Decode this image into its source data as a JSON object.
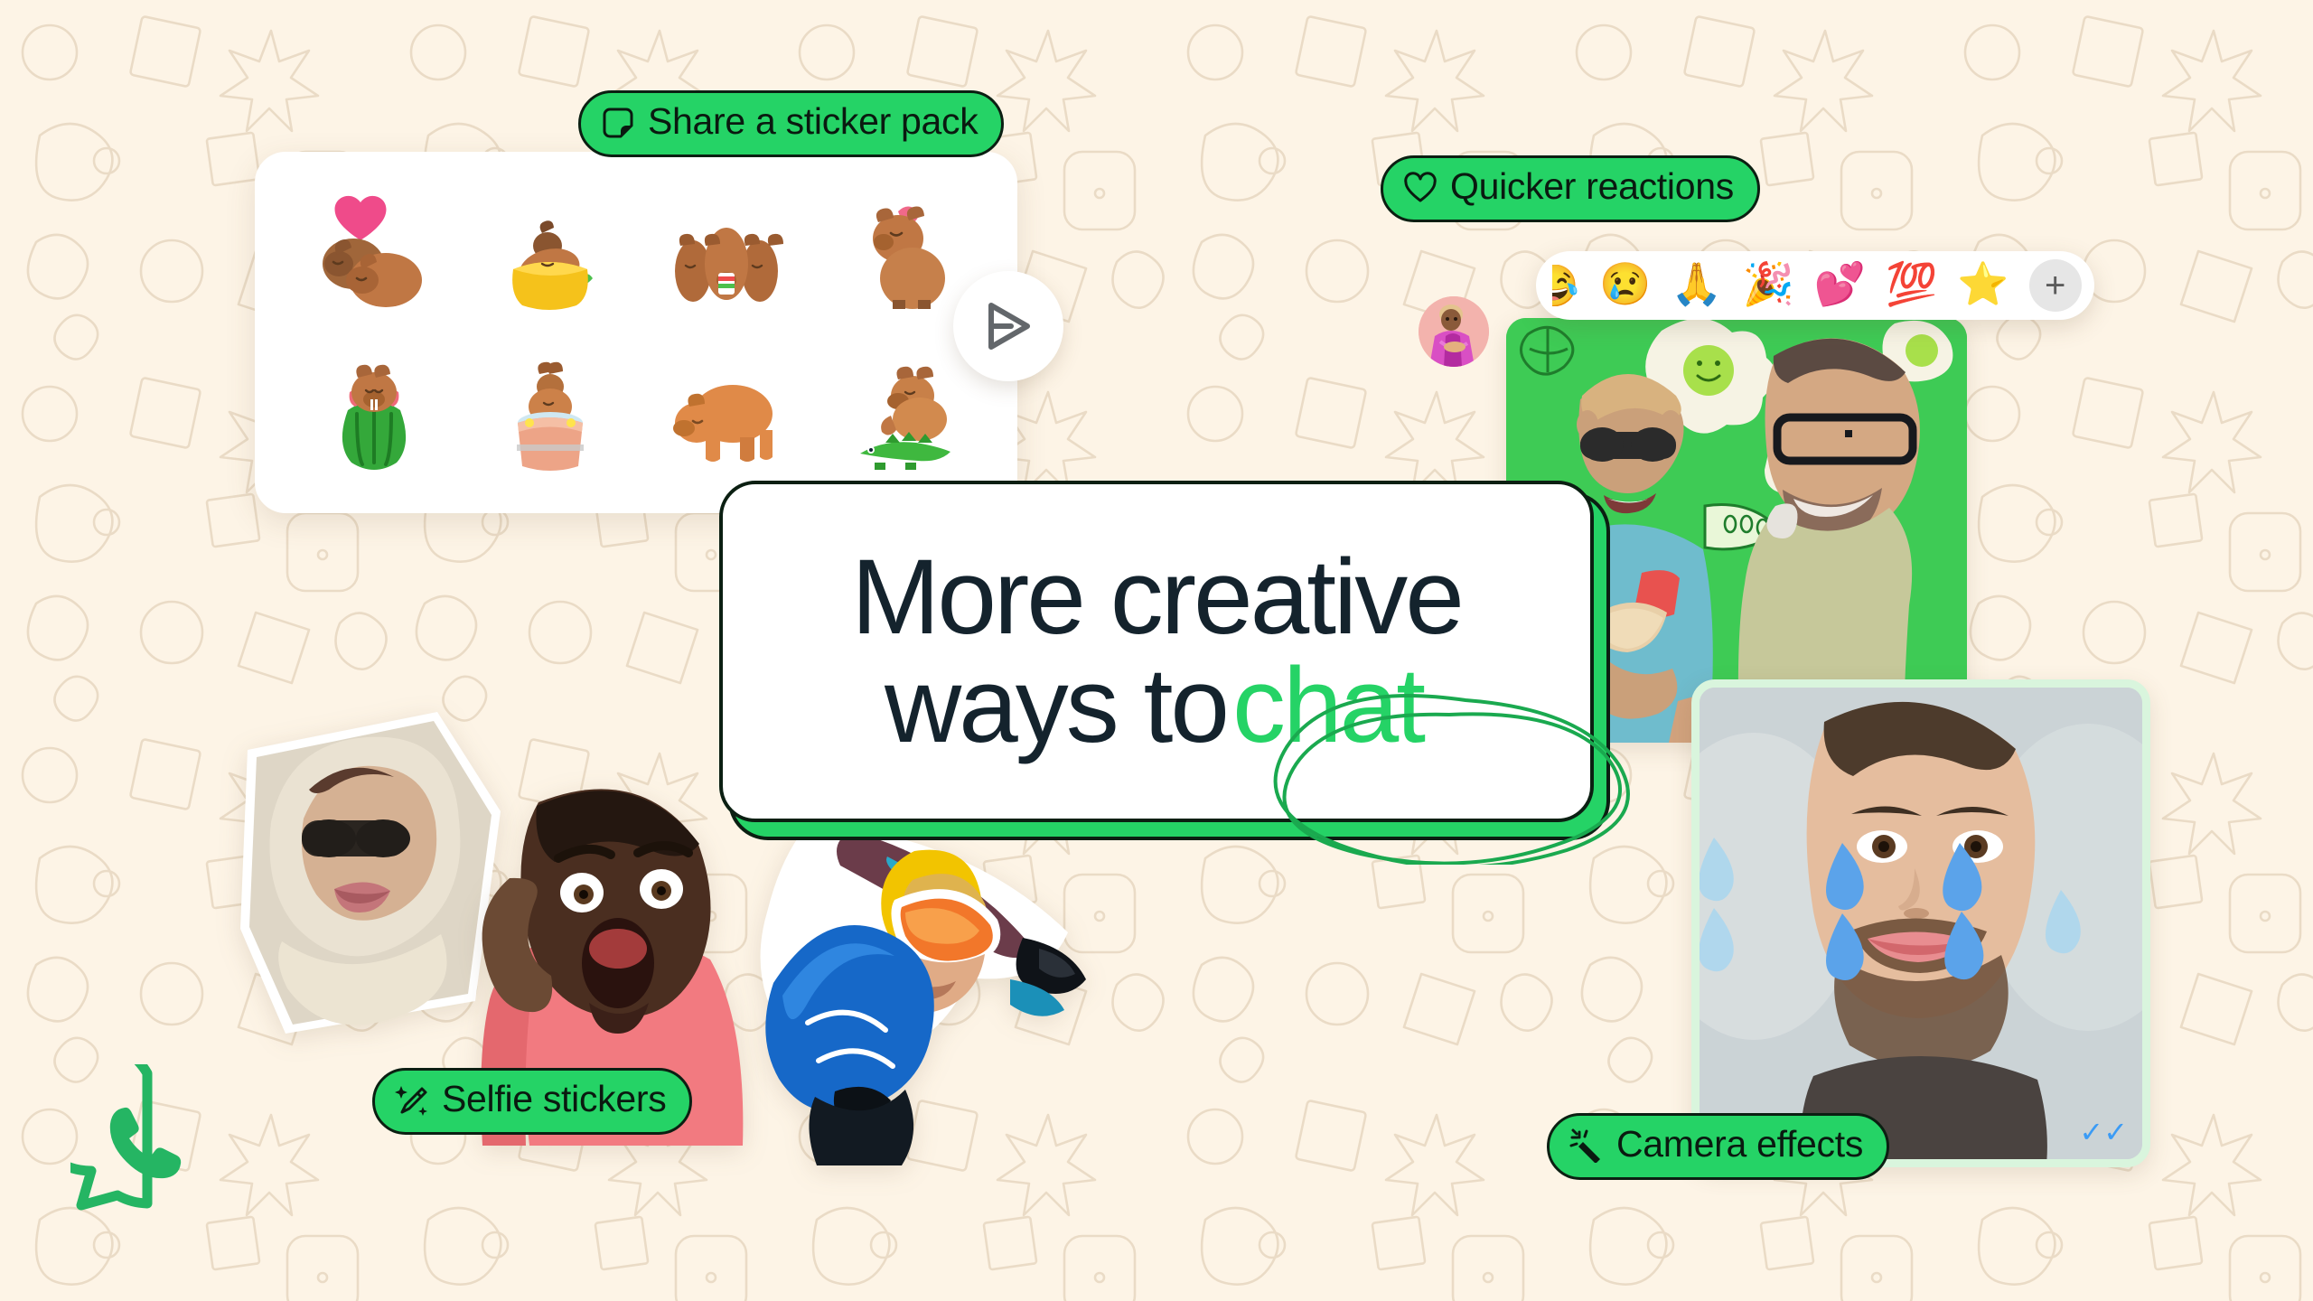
{
  "brand": {
    "name": "WhatsApp",
    "logo_icon": "whatsapp-logo-icon",
    "green": "#25d366",
    "dark": "#0b1f12",
    "background": "#fdf4e6",
    "headline_color": "#14232d"
  },
  "headline": {
    "line1": "More creative",
    "line2_prefix": "ways to",
    "accent_word": "chat",
    "full_text": "More creative ways to chat"
  },
  "labels": [
    {
      "id": "share-sticker-pack",
      "text": "Share a sticker pack",
      "icon": "sticker-icon"
    },
    {
      "id": "quicker-reactions",
      "text": "Quicker reactions",
      "icon": "heart-outline-icon"
    },
    {
      "id": "selfie-stickers",
      "text": "Selfie stickers",
      "icon": "magic-wand-sparkle-icon"
    },
    {
      "id": "camera-effects",
      "text": "Camera effects",
      "icon": "magic-wand-icon"
    }
  ],
  "sticker_panel": {
    "send_icon": "send-plane-icon",
    "stickers": [
      {
        "name": "capybara-pair-with-heart",
        "emoji": "🦫"
      },
      {
        "name": "capybara-in-taco",
        "emoji": "🌮"
      },
      {
        "name": "capybara-trio-with-drink",
        "emoji": "🧋"
      },
      {
        "name": "capybara-with-bird-on-head",
        "emoji": "🐦"
      },
      {
        "name": "capybara-in-watermelon",
        "emoji": "🍉"
      },
      {
        "name": "capybara-in-hot-tub",
        "emoji": "🛁"
      },
      {
        "name": "capybara-standing",
        "emoji": "🦫"
      },
      {
        "name": "capybara-on-crocodile",
        "emoji": "🐊"
      }
    ]
  },
  "reaction_bar": {
    "partial_emoji": "😂",
    "emojis": [
      {
        "name": "crying-face-emoji",
        "glyph": "😢"
      },
      {
        "name": "folded-hands-emoji",
        "glyph": "🙏"
      },
      {
        "name": "party-popper-emoji",
        "glyph": "🎉"
      },
      {
        "name": "two-hearts-emoji",
        "glyph": "💕"
      },
      {
        "name": "hundred-points-emoji",
        "glyph": "💯"
      },
      {
        "name": "star-emoji",
        "glyph": "⭐"
      }
    ],
    "add_button": "+"
  },
  "media": {
    "couple_photo": {
      "name": "couple-selfie-green-background",
      "doodles": [
        "fried-egg",
        "lime-slice",
        "leaf"
      ]
    },
    "camera_photo": {
      "name": "crying-filter-selfie",
      "effect": "blue teardrops",
      "read_receipt": "✓✓"
    },
    "selfie_stickers": [
      {
        "name": "hooded-sunglasses-selfie-sticker"
      },
      {
        "name": "shocked-face-selfie-sticker"
      },
      {
        "name": "snowboarder-selfie-sticker"
      }
    ],
    "avatar_sticker": {
      "name": "avatar-reaction-sticker"
    }
  }
}
